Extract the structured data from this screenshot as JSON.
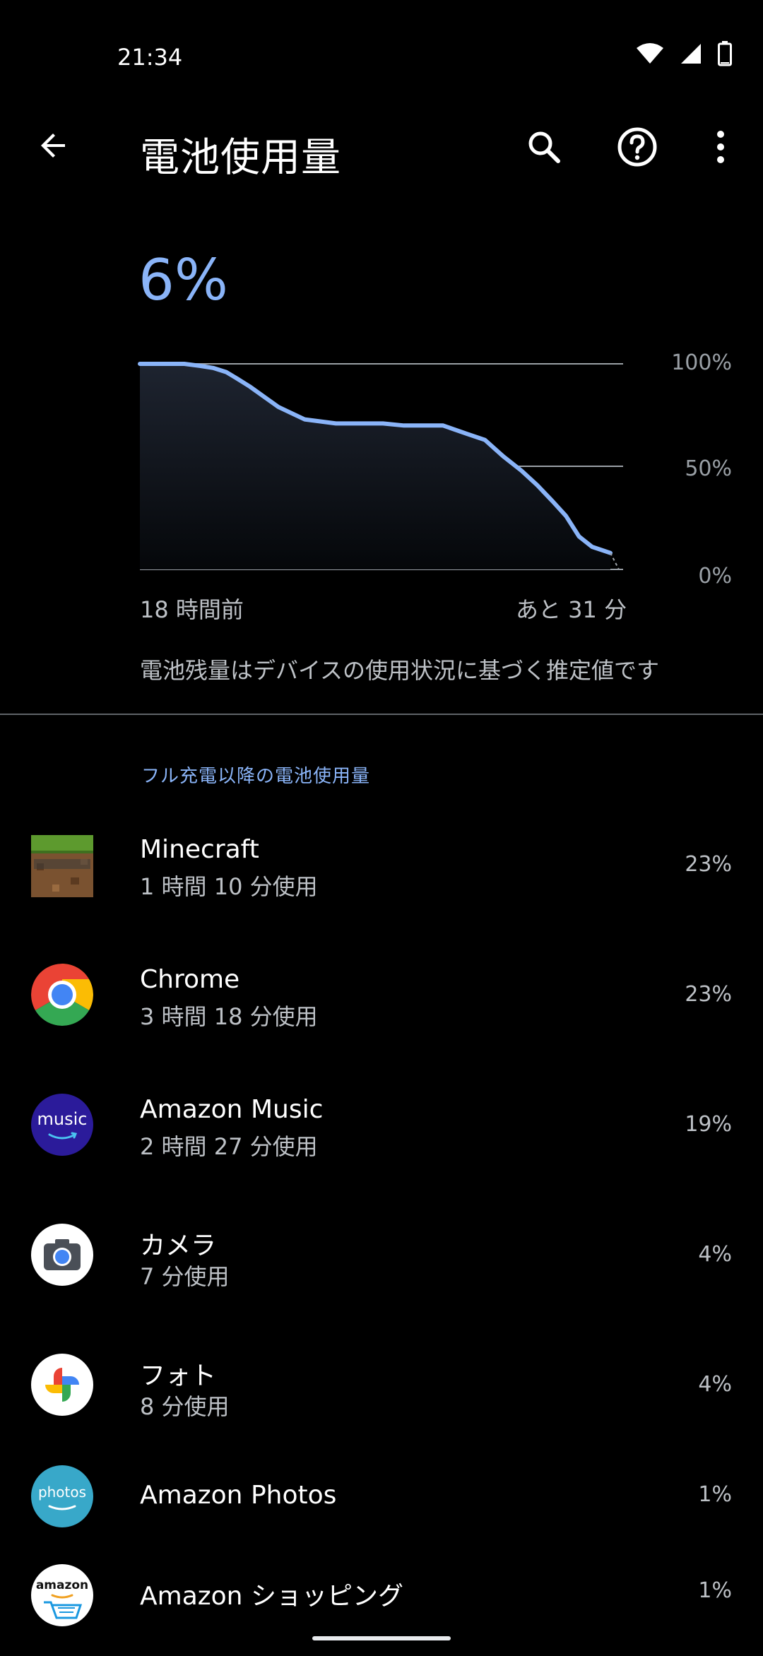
{
  "status_bar": {
    "time": "21:34",
    "icons": [
      "wifi-icon",
      "signal-icon",
      "battery-icon"
    ]
  },
  "app_bar": {
    "title": "電池使用量",
    "back_icon": "arrow-back-icon",
    "actions": [
      "search-icon",
      "help-icon",
      "more-vert-icon"
    ]
  },
  "battery": {
    "level": "6%"
  },
  "chart_data": {
    "type": "area",
    "x_start_label": "18 時間前",
    "x_end_label": "あと 31 分",
    "y_ticks": [
      "100%",
      "50%",
      "0%"
    ],
    "ylim": [
      0,
      100
    ],
    "x": [
      0,
      1.7,
      2.3,
      2.8,
      3.3,
      3.7,
      4.2,
      5.3,
      6.3,
      7.5,
      8.9,
      9.3,
      10.1,
      10.9,
      11.6,
      12.5,
      13.2,
      13.9,
      14.6,
      15.2,
      15.8,
      16.3,
      16.8,
      17.3,
      18
    ],
    "values": [
      100,
      100,
      99,
      98,
      96,
      93,
      89,
      79,
      73,
      71,
      71,
      71,
      70,
      70,
      70,
      66,
      63,
      55,
      48,
      41,
      33,
      26,
      16,
      11,
      8
    ],
    "line_color": "#8ab4f8",
    "gridlines": true
  },
  "estimate_note": "電池残量はデバイスの使用状況に基づく推定値です",
  "section_header": "フル充電以降の電池使用量",
  "apps": [
    {
      "name": "Minecraft",
      "usage": "1 時間 10 分使用",
      "percent": "23%",
      "icon": "minecraft-icon"
    },
    {
      "name": "Chrome",
      "usage": "3 時間 18 分使用",
      "percent": "23%",
      "icon": "chrome-icon"
    },
    {
      "name": "Amazon Music",
      "usage": "2 時間 27 分使用",
      "percent": "19%",
      "icon": "amazon-music-icon",
      "icon_text": "music"
    },
    {
      "name": "カメラ",
      "usage": "7 分使用",
      "percent": "4%",
      "icon": "camera-icon"
    },
    {
      "name": "フォト",
      "usage": "8 分使用",
      "percent": "4%",
      "icon": "photos-icon"
    },
    {
      "name": "Amazon Photos",
      "usage": "",
      "percent": "1%",
      "icon": "amazon-photos-icon",
      "icon_text": "photos"
    },
    {
      "name": "Amazon ショッピング",
      "usage": "",
      "percent": "1%",
      "icon": "amazon-shopping-icon",
      "icon_text": "amazon"
    }
  ],
  "colors": {
    "accent": "#8ab4f8",
    "background": "#000000"
  }
}
